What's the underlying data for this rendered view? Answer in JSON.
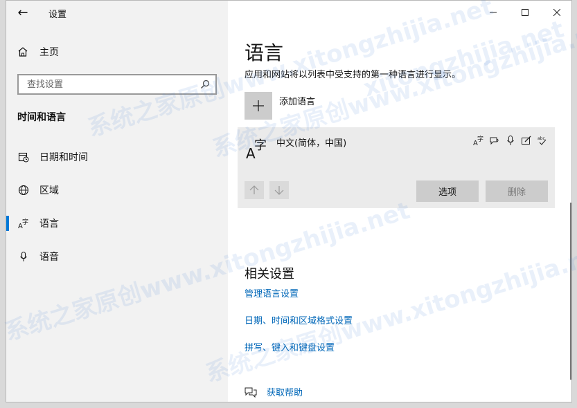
{
  "window": {
    "title": "设置",
    "back_icon": "back-arrow-icon",
    "minimize_icon": "minimize-icon",
    "maximize_icon": "maximize-icon",
    "close_icon": "close-icon"
  },
  "sidebar": {
    "home_label": "主页",
    "home_icon": "home-icon",
    "search_placeholder": "查找设置",
    "search_icon": "search-icon",
    "section_title": "时间和语言",
    "items": [
      {
        "label": "日期和时间",
        "icon": "calendar-clock-icon",
        "active": false
      },
      {
        "label": "区域",
        "icon": "globe-icon",
        "active": false
      },
      {
        "label": "语言",
        "icon": "language-icon",
        "active": true
      },
      {
        "label": "语音",
        "icon": "microphone-icon",
        "active": false
      }
    ]
  },
  "main": {
    "title": "语言",
    "description": "应用和网站将以列表中受支持的第一种语言进行显示。",
    "add_language_label": "添加语言",
    "add_icon": "plus-icon",
    "language": {
      "name": "中文(简体，中国)",
      "icon": "language-icon",
      "feature_icons": [
        "display-language-icon",
        "speech-icon",
        "microphone-icon",
        "handwriting-icon",
        "spellcheck-icon"
      ]
    },
    "move_up_icon": "arrow-up-icon",
    "move_down_icon": "arrow-down-icon",
    "options_label": "选项",
    "delete_label": "删除",
    "related_title": "相关设置",
    "related_links": [
      "管理语言设置",
      "日期、时间和区域格式设置",
      "拼写、键入和键盘设置"
    ],
    "help_label": "获取帮助",
    "help_icon": "help-chat-icon"
  },
  "watermark": {
    "text": "系统之家原创www.xitongzhijia.net",
    "short_text": "xitongzhijia.net"
  },
  "colors": {
    "accent": "#0078d7",
    "link": "#0067b8",
    "sidebar_bg": "#f2f2f2",
    "button_bg": "#cccccc",
    "panel_bg": "#ebebeb"
  }
}
